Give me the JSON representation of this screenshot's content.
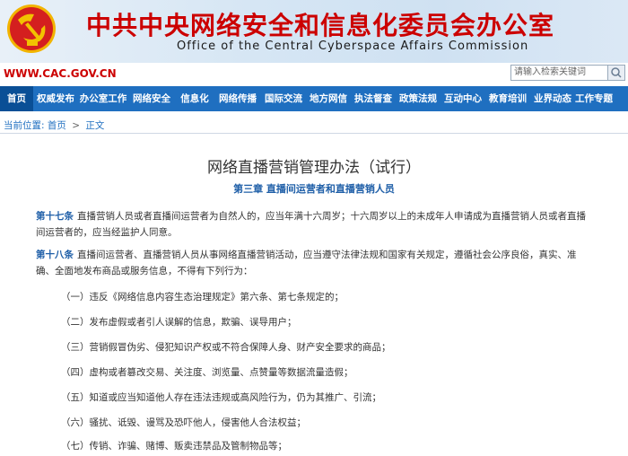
{
  "header": {
    "site_name_cn": "中共中央网络安全和信息化委员会办公室",
    "site_name_en": "Office of the Central Cyberspace Affairs Commission",
    "domain": "WWW.CAC.GOV.CN",
    "search_placeholder": "请输入检索关键词",
    "colors": {
      "brand_red": "#cc0000",
      "nav_blue": "#1f6fc0"
    }
  },
  "nav": {
    "items": [
      "首页",
      "权威发布",
      "办公室工作",
      "网络安全",
      "信息化",
      "网络传播",
      "国际交流",
      "地方网信",
      "执法督查",
      "政策法规",
      "互动中心",
      "教育培训",
      "业界动态",
      "工作专题"
    ]
  },
  "breadcrumb": {
    "prefix": "当前位置:",
    "home": "首页",
    "current": "正文",
    "separator": ">"
  },
  "article": {
    "title": "网络直播营销管理办法（试行）",
    "chapter": "第三章  直播间运营者和直播营销人员",
    "paragraphs": [
      {
        "article": "第十七条",
        "text": "直播营销人员或者直播间运营者为自然人的，应当年满十六周岁；十六周岁以上的未成年人申请成为直播营销人员或者直播间运营者的，应当经监护人同意。"
      },
      {
        "article": "第十八条",
        "text": "直播间运营者、直播营销人员从事网络直播营销活动，应当遵守法律法规和国家有关规定，遵循社会公序良俗，真实、准确、全面地发布商品或服务信息，不得有下列行为："
      }
    ],
    "items": [
      "（一）违反《网络信息内容生态治理规定》第六条、第七条规定的；",
      "（二）发布虚假或者引人误解的信息，欺骗、误导用户；",
      "（三）营销假冒伪劣、侵犯知识产权或不符合保障人身、财产安全要求的商品；",
      "（四）虚构或者篡改交易、关注度、浏览量、点赞量等数据流量造假；",
      "（五）知道或应当知道他人存在违法违规或高风险行为，仍为其推广、引流；",
      "（六）骚扰、诋毁、谩骂及恐吓他人，侵害他人合法权益；",
      "（七）传销、诈骗、赌博、贩卖违禁品及管制物品等；"
    ]
  }
}
